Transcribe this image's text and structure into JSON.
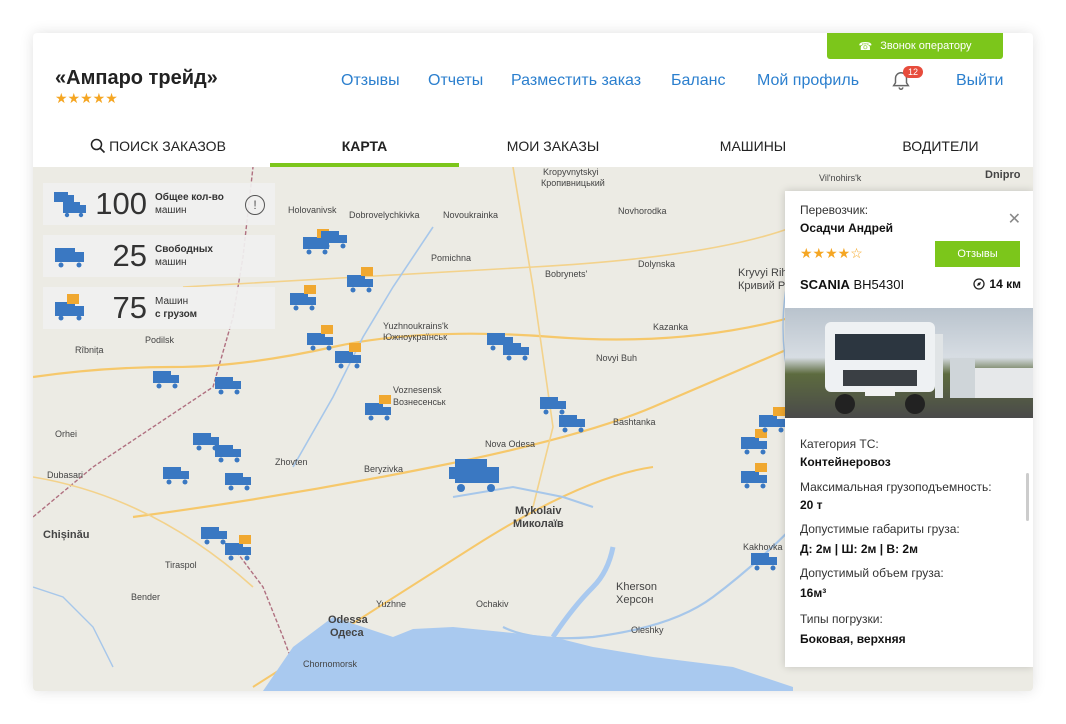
{
  "header": {
    "call_label": "Звонок оператору",
    "brand": "«Ампаро трейд»",
    "brand_stars": "★★★★★",
    "nav": [
      "Отзывы",
      "Отчеты",
      "Разместить заказ",
      "Баланс",
      "Мой профиль"
    ],
    "notifications": "12",
    "logout": "Выйти"
  },
  "tabs": [
    "ПОИСК ЗАКАЗОВ",
    "КАРТА",
    "МОИ ЗАКАЗЫ",
    "МАШИНЫ",
    "ВОДИТЕЛИ"
  ],
  "active_tab": "КАРТА",
  "stats": [
    {
      "num": "100",
      "line1": "Общее кол-во",
      "line2": "машин"
    },
    {
      "num": "25",
      "line1": "Свободных",
      "line2": "машин"
    },
    {
      "num": "75",
      "line1": "Машин",
      "line2": "с грузом"
    }
  ],
  "map_labels": [
    "Kropyvnytskyi",
    "Кропивницький",
    "Holovanivsk",
    "Dobrovelychkivka",
    "Novoukrainka",
    "Novhorodka",
    "Pomichna",
    "Bobrynets'",
    "Dolynska",
    "Kryvyi Rih",
    "Кривий Ріг",
    "Yuzhnoukrains'k",
    "Южноукраїнськ",
    "Rîbnița",
    "Podilsk",
    "Voznesensk",
    "Вознесенськ",
    "Kazanka",
    "Novyi Buh",
    "Bashtanka",
    "Nova Odesa",
    "Orhei",
    "Dubasari",
    "Zhovten",
    "Beryzivka",
    "Mykolaiv",
    "Миколаїв",
    "Chișinău",
    "Tiraspol",
    "Bender",
    "Odessa",
    "Одеса",
    "Yuzhne",
    "Ochakiv",
    "Kherson",
    "Херсон",
    "Oleshky",
    "Kakhovka",
    "Chornomorsk",
    "Vil'nohirs'k",
    "Dnipro"
  ],
  "panel": {
    "carrier_label": "Перевозчик:",
    "carrier_name": "Осадчи Андрей",
    "stars": "★★★★☆",
    "reviews_btn": "Отзывы",
    "truck_model": "SCANIA",
    "truck_plate": "ВН5430І",
    "distance": "14 км",
    "category_label": "Категория ТС:",
    "category": "Контейнеровоз",
    "payload_label": "Максимальная грузоподъемность:",
    "payload": "20 т",
    "dims_label": "Допустимые габариты груза:",
    "dims": "Д: 2м | Ш: 2м | В: 2м",
    "volume_label": "Допустимый объем груза:",
    "volume": "16м³",
    "loading_label": "Типы погрузки:",
    "loading": "Боковая, верхняя"
  },
  "colors": {
    "accent": "#7cc61b",
    "link": "#2b7fce",
    "truck": "#3a78c2",
    "cargo": "#f0a830"
  }
}
